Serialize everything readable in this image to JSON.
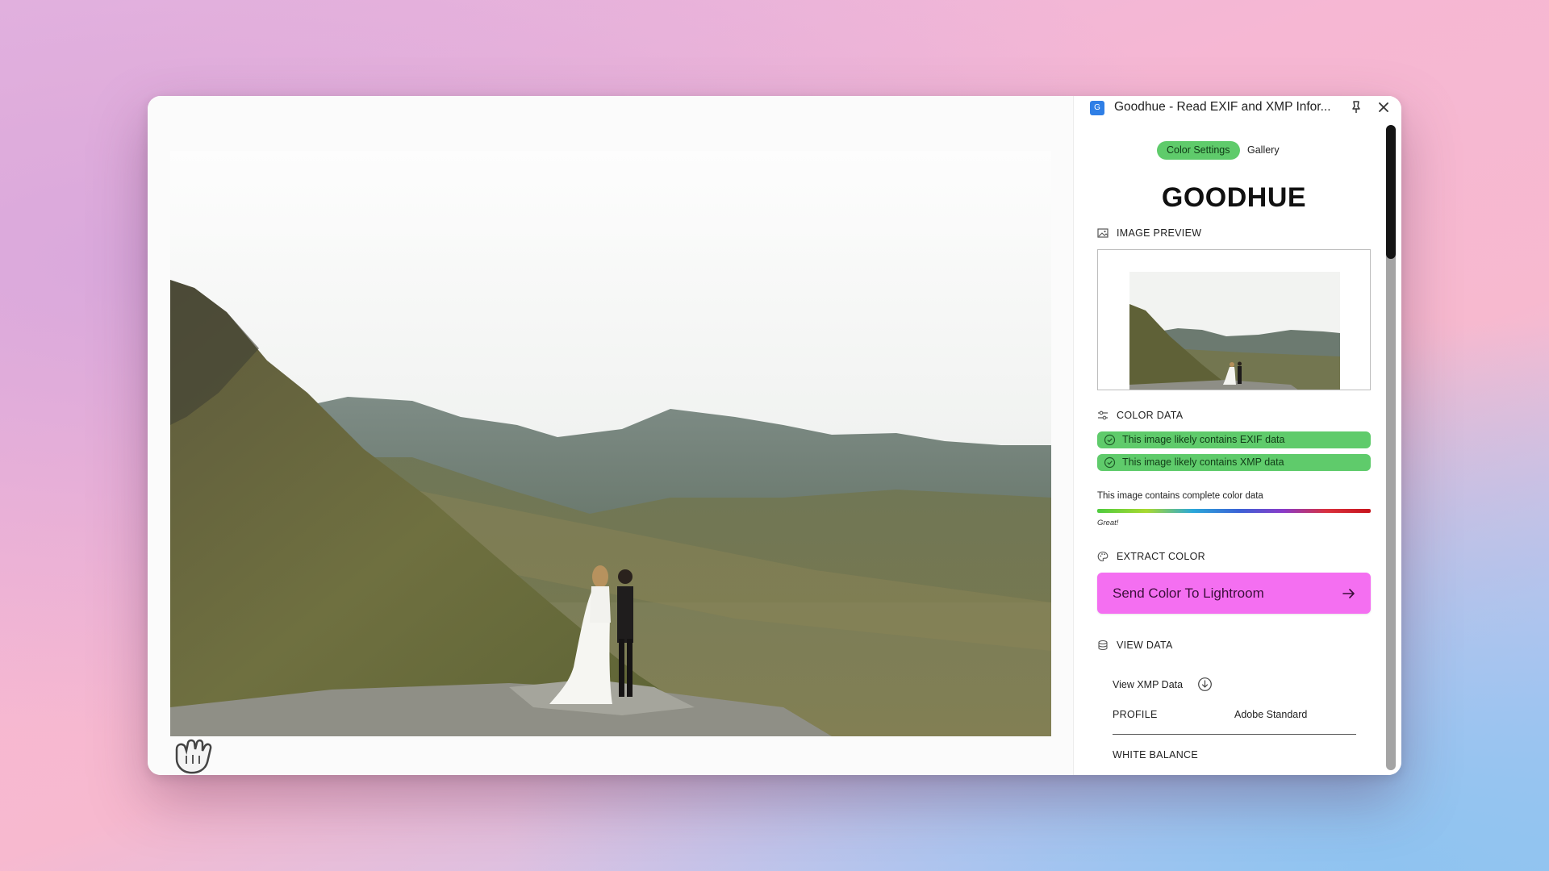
{
  "window": {
    "title": "Goodhue - Read EXIF and XMP Infor...",
    "app_icon": "G"
  },
  "icons": {
    "app": "app-logo-icon",
    "pin": "pin-icon",
    "close": "close-icon",
    "image_preview": "image-icon",
    "color_data": "sliders-icon",
    "extract_color": "palette-icon",
    "view_data": "database-icon",
    "status_check": "check-circle-icon",
    "arrow": "arrow-right-icon",
    "download": "download-circle-icon",
    "cursor": "grab-hand-icon"
  },
  "tabs": {
    "active": "Color Settings",
    "gallery": "Gallery"
  },
  "brand": "GOODHUE",
  "sections": {
    "image_preview": "IMAGE PREVIEW",
    "color_data": "COLOR DATA",
    "extract_color": "EXTRACT COLOR",
    "view_data": "VIEW DATA"
  },
  "color_data": {
    "exif_status": "This image likely contains EXIF data",
    "xmp_status": "This image likely contains XMP data",
    "completeness": "This image contains complete color data",
    "rating": "Great!"
  },
  "extract": {
    "button_label": "Send Color To Lightroom"
  },
  "view_data": {
    "xmp_link": "View XMP Data",
    "profile_label": "PROFILE",
    "profile_value": "Adobe Standard",
    "white_balance_label": "WHITE BALANCE"
  },
  "colors": {
    "accent_green": "#5fcb6b",
    "accent_pink": "#f46ff1",
    "scroll_thumb": "#151515"
  }
}
